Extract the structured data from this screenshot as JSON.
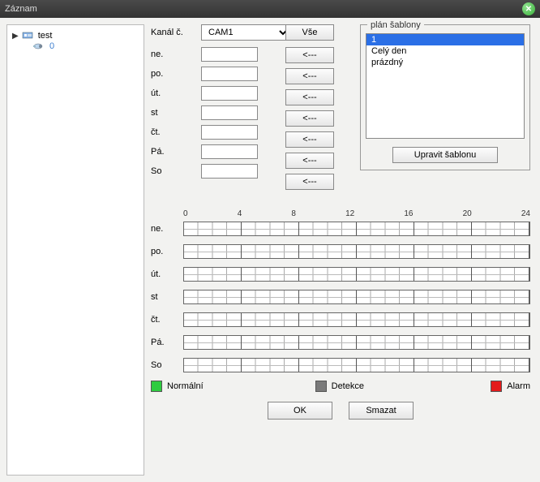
{
  "title": "Záznam",
  "tree": {
    "root": "test",
    "child_count": "0"
  },
  "labels": {
    "channel": "Kanál č.",
    "all": "Vše",
    "arrow": "<---",
    "templates_title": "plán šablony",
    "edit_template": "Upravit šablonu",
    "ok": "OK",
    "delete": "Smazat"
  },
  "channel_value": "CAM1",
  "days": [
    "ne.",
    "po.",
    "út.",
    "st",
    "čt.",
    "Pá.",
    "So"
  ],
  "day_values": [
    "",
    "",
    "",
    "",
    "",
    "",
    ""
  ],
  "templates": [
    "1",
    "Celý den",
    "prázdný"
  ],
  "selected_template_index": 0,
  "axis": [
    "0",
    "4",
    "8",
    "12",
    "16",
    "20",
    "24"
  ],
  "legend": {
    "normal": "Normální",
    "detect": "Detekce",
    "alarm": "Alarm"
  }
}
